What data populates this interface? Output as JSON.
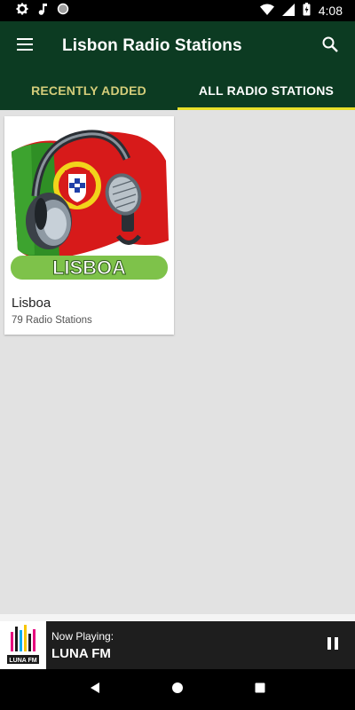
{
  "status_bar": {
    "time": "4:08",
    "icons": [
      "gear-icon",
      "music-note-icon",
      "circle-icon",
      "wifi-icon",
      "signal-icon",
      "battery-icon"
    ]
  },
  "app_bar": {
    "title": "Lisbon Radio Stations",
    "menu_icon": "hamburger-menu-icon",
    "search_icon": "search-icon"
  },
  "tabs": [
    {
      "label": "RECENTLY ADDED",
      "active": false
    },
    {
      "label": "ALL RADIO STATIONS",
      "active": true
    }
  ],
  "cards": [
    {
      "image_banner_text": "LISBOA",
      "title": "Lisboa",
      "subtitle": "79 Radio Stations"
    }
  ],
  "now_playing": {
    "label": "Now Playing:",
    "station": "LUNA FM",
    "logo_text": "LUNA FM",
    "control_icon": "pause-icon"
  },
  "nav_bar": {
    "buttons": [
      "back-icon",
      "home-icon",
      "recents-icon"
    ]
  },
  "colors": {
    "app_bar": "#0c3b22",
    "tab_inactive_text": "#d4cd7a",
    "tab_indicator": "#e8e02a",
    "content_bg": "#e2e2e2",
    "player_bg": "#1e1e1e"
  }
}
